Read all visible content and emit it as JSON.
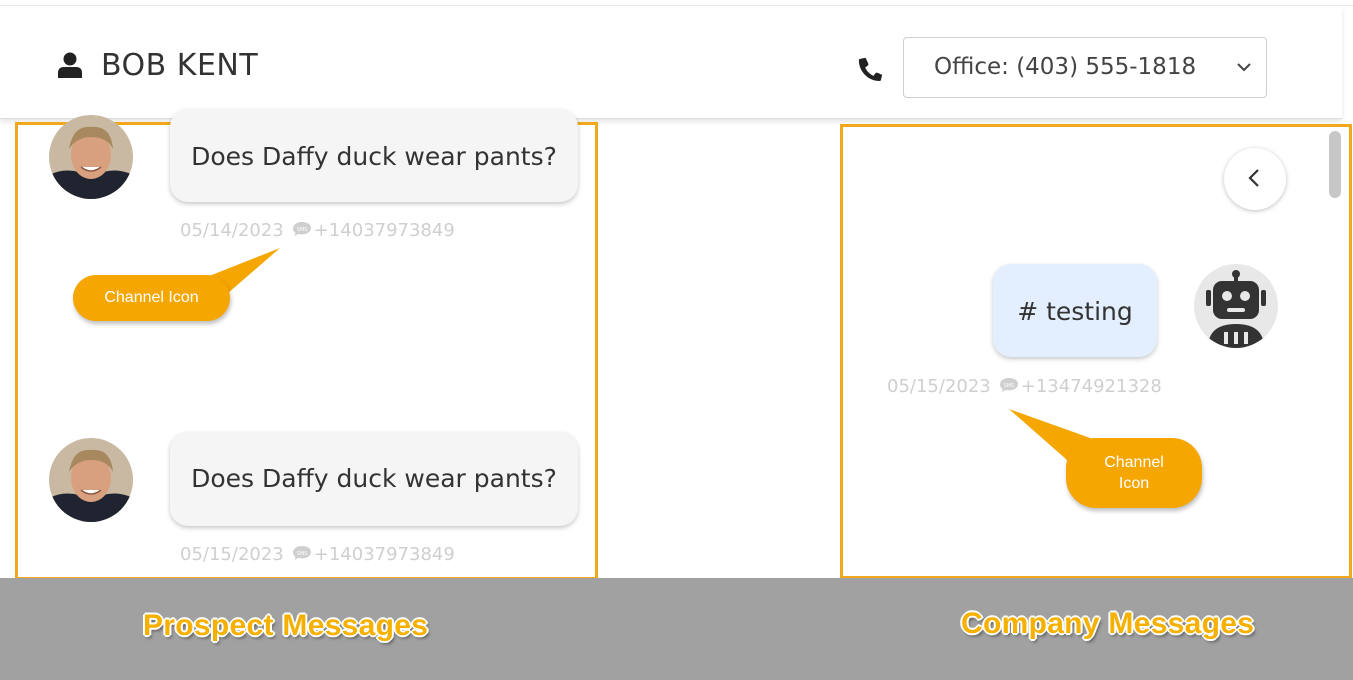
{
  "header": {
    "contact_name": "BOB KENT",
    "phone_value": "Office: (403) 555-1818",
    "icons": {
      "contact": "user-icon",
      "phone": "phone-icon",
      "dropdown": "chevron-down-icon"
    }
  },
  "prospect_messages": [
    {
      "text": "Does Daffy duck wear pants?",
      "date": "05/14/2023",
      "number": "+14037973849",
      "channel_icon": "sms-chat-icon"
    },
    {
      "text": "Does Daffy duck wear pants?",
      "date": "05/15/2023",
      "number": "+14037973849",
      "channel_icon": "sms-chat-icon"
    }
  ],
  "company_messages": [
    {
      "text": "# testing",
      "date": "05/15/2023",
      "number": "+13474921328",
      "channel_icon": "sms-chat-icon"
    }
  ],
  "callouts": {
    "left": "Channel Icon",
    "right_line1": "Channel",
    "right_line2": "Icon"
  },
  "labels": {
    "prospect": "Prospect Messages",
    "company": "Company Messages"
  },
  "colors": {
    "highlight": "#f2a81d",
    "callout": "#f5a600",
    "company_bubble": "#e3effe",
    "prospect_bubble": "#f5f5f5",
    "band": "#a1a1a1"
  }
}
